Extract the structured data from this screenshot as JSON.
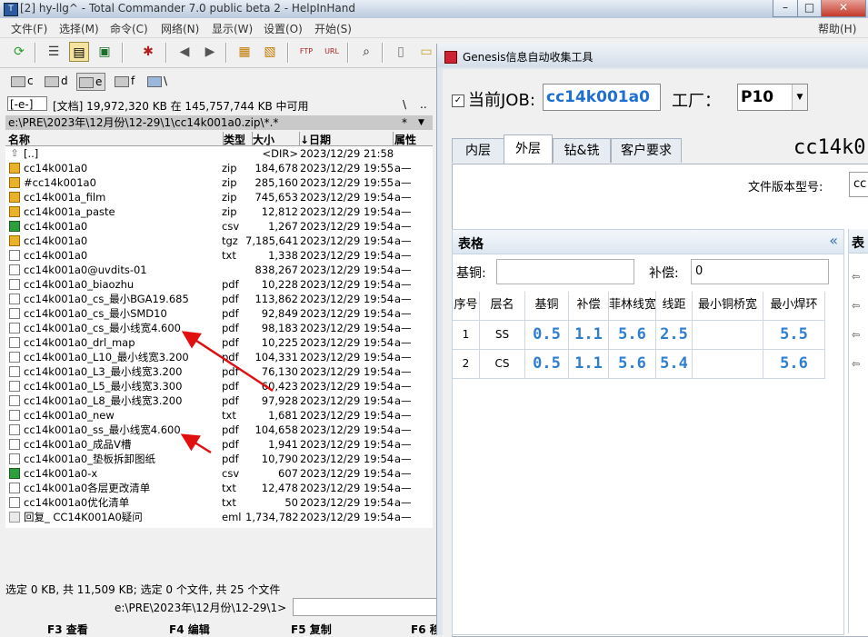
{
  "tc": {
    "window_title": "[2] hy-llg^ - Total Commander 7.0 public beta 2 - HelpInHand",
    "menus": [
      "文件(F)",
      "选择(M)",
      "命令(C)",
      "网络(N)",
      "显示(W)",
      "设置(O)",
      "开始(S)"
    ],
    "help_menu": "帮助(H)",
    "drives": [
      "c",
      "d",
      "e",
      "f",
      "\\"
    ],
    "drive_select": "[-e-]",
    "space_info": "[文档]  19,972,320 KB 在 145,757,744 KB 中可用",
    "path_root_btn": "\\",
    "path_up_btn": "..",
    "current_path": "e:\\PRE\\2023年\\12月份\\12-29\\1\\cc14k001a0.zip\\*.*",
    "path_filter": "*",
    "columns": {
      "name": "名称",
      "type": "类型",
      "size": "大小",
      "date": "↓日期",
      "attr": "属性"
    },
    "files": [
      {
        "name": "[..]",
        "type": "",
        "size": "<DIR>",
        "date": "2023/12/29 21:58—",
        "attr": "",
        "icon": "up-folder"
      },
      {
        "name": "cc14k001a0",
        "type": "zip",
        "size": "184,678",
        "date": "2023/12/29 19:55-",
        "attr": "a—",
        "icon": "zip"
      },
      {
        "name": "#cc14k001a0",
        "type": "zip",
        "size": "285,160",
        "date": "2023/12/29 19:55-",
        "attr": "a—",
        "icon": "zip"
      },
      {
        "name": "cc14k001a_film",
        "type": "zip",
        "size": "745,653",
        "date": "2023/12/29 19:54-",
        "attr": "a—",
        "icon": "zip"
      },
      {
        "name": "cc14k001a_paste",
        "type": "zip",
        "size": "12,812",
        "date": "2023/12/29 19:54-",
        "attr": "a—",
        "icon": "zip"
      },
      {
        "name": "cc14k001a0",
        "type": "csv",
        "size": "1,267",
        "date": "2023/12/29 19:54-",
        "attr": "a—",
        "icon": "csv"
      },
      {
        "name": "cc14k001a0",
        "type": "tgz",
        "size": "7,185,641",
        "date": "2023/12/29 19:54-",
        "attr": "a—",
        "icon": "zip"
      },
      {
        "name": "cc14k001a0",
        "type": "txt",
        "size": "1,338",
        "date": "2023/12/29 19:54-",
        "attr": "a—",
        "icon": "doc"
      },
      {
        "name": "cc14k001a0@uvdits-01",
        "type": "",
        "size": "838,267",
        "date": "2023/12/29 19:54-",
        "attr": "a—",
        "icon": "doc"
      },
      {
        "name": "cc14k001a0_biaozhu",
        "type": "pdf",
        "size": "10,228",
        "date": "2023/12/29 19:54-",
        "attr": "a—",
        "icon": "doc"
      },
      {
        "name": "cc14k001a0_cs_最小BGA19.685",
        "type": "pdf",
        "size": "113,862",
        "date": "2023/12/29 19:54-",
        "attr": "a—",
        "icon": "doc"
      },
      {
        "name": "cc14k001a0_cs_最小SMD10",
        "type": "pdf",
        "size": "92,849",
        "date": "2023/12/29 19:54-",
        "attr": "a—",
        "icon": "doc"
      },
      {
        "name": "cc14k001a0_cs_最小线宽4.600",
        "type": "pdf",
        "size": "98,183",
        "date": "2023/12/29 19:54-",
        "attr": "a—",
        "icon": "doc"
      },
      {
        "name": "cc14k001a0_drl_map",
        "type": "pdf",
        "size": "10,225",
        "date": "2023/12/29 19:54-",
        "attr": "a—",
        "icon": "doc"
      },
      {
        "name": "cc14k001a0_L10_最小线宽3.200",
        "type": "pdf",
        "size": "104,331",
        "date": "2023/12/29 19:54-",
        "attr": "a—",
        "icon": "doc"
      },
      {
        "name": "cc14k001a0_L3_最小线宽3.200",
        "type": "pdf",
        "size": "76,130",
        "date": "2023/12/29 19:54-",
        "attr": "a—",
        "icon": "doc"
      },
      {
        "name": "cc14k001a0_L5_最小线宽3.300",
        "type": "pdf",
        "size": "60,423",
        "date": "2023/12/29 19:54-",
        "attr": "a—",
        "icon": "doc"
      },
      {
        "name": "cc14k001a0_L8_最小线宽3.200",
        "type": "pdf",
        "size": "97,928",
        "date": "2023/12/29 19:54-",
        "attr": "a—",
        "icon": "doc"
      },
      {
        "name": "cc14k001a0_new",
        "type": "txt",
        "size": "1,681",
        "date": "2023/12/29 19:54-",
        "attr": "a—",
        "icon": "doc"
      },
      {
        "name": "cc14k001a0_ss_最小线宽4.600",
        "type": "pdf",
        "size": "104,658",
        "date": "2023/12/29 19:54-",
        "attr": "a—",
        "icon": "doc"
      },
      {
        "name": "cc14k001a0_成品V槽",
        "type": "pdf",
        "size": "1,941",
        "date": "2023/12/29 19:54-",
        "attr": "a—",
        "icon": "doc"
      },
      {
        "name": "cc14k001a0_垫板拆卸图纸",
        "type": "pdf",
        "size": "10,790",
        "date": "2023/12/29 19:54-",
        "attr": "a—",
        "icon": "doc"
      },
      {
        "name": "cc14k001a0-x",
        "type": "csv",
        "size": "607",
        "date": "2023/12/29 19:54-",
        "attr": "a—",
        "icon": "csv"
      },
      {
        "name": "cc14k001a0各层更改清单",
        "type": "txt",
        "size": "12,478",
        "date": "2023/12/29 19:54-",
        "attr": "a—",
        "icon": "doc"
      },
      {
        "name": "cc14k001a0优化清单",
        "type": "txt",
        "size": "50",
        "date": "2023/12/29 19:54-",
        "attr": "a—",
        "icon": "doc"
      },
      {
        "name": "回复_ CC14K001A0疑问",
        "type": "eml",
        "size": "1,734,782",
        "date": "2023/12/29 19:54-",
        "attr": "a—",
        "icon": "eml"
      }
    ],
    "status": "选定 0 KB, 共 11,509 KB; 选定 0 个文件, 共 25 个文件",
    "cmd_path": "e:\\PRE\\2023年\\12月份\\12-29\\1>",
    "fkeys": [
      "F3 查看",
      "F4 编辑",
      "F5 复制",
      "F6 移"
    ]
  },
  "genesis": {
    "title": "Genesis信息自动收集工具",
    "job_label": "当前JOB:",
    "job_value": "cc14k001a0",
    "factory_label": "工厂：",
    "factory_value": "P10",
    "tabs": [
      "内层",
      "外层",
      "钻&铣",
      "客户要求"
    ],
    "active_tab": "外层",
    "job_big": "cc14k0",
    "version_label": "文件版本型号:",
    "version_value": "cc",
    "grid_title": "表格",
    "collapse_glyph": "«",
    "base_copper_label": "基铜:",
    "base_copper_value": "",
    "comp_label": "补偿:",
    "comp_value": "0",
    "columns": [
      "序号",
      "层名",
      "基铜",
      "补偿",
      "菲林线宽",
      "线距",
      "最小铜桥宽",
      "最小焊环"
    ],
    "rows": [
      [
        "1",
        "SS",
        "0.5",
        "1.1",
        "5.6",
        "2.5",
        "",
        "5.5"
      ],
      [
        "2",
        "CS",
        "0.5",
        "1.1",
        "5.6",
        "5.4",
        "",
        "5.6"
      ]
    ],
    "right_panel_head": "表"
  },
  "colors": {
    "accent_blue": "#2f7fd0",
    "annotation_red": "#e01010"
  }
}
